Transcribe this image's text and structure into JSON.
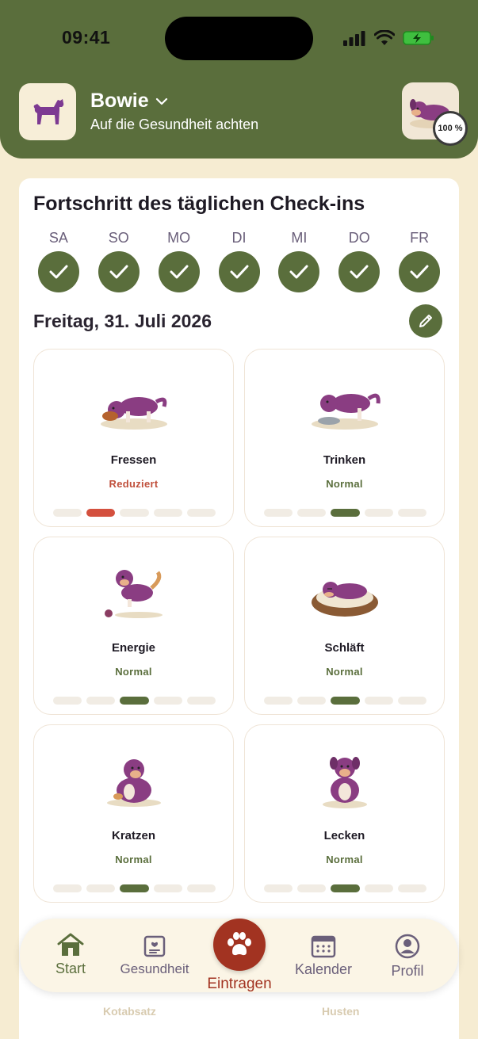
{
  "status_bar": {
    "time": "09:41"
  },
  "header": {
    "pet_name": "Bowie",
    "subtitle": "Auf die Gesundheit achten",
    "progress": "100 %",
    "progress_value": 100
  },
  "checkin": {
    "title": "Fortschritt des täglichen Check-ins",
    "days": [
      {
        "label": "SA",
        "done": true
      },
      {
        "label": "SO",
        "done": true
      },
      {
        "label": "MO",
        "done": true
      },
      {
        "label": "DI",
        "done": true
      },
      {
        "label": "MI",
        "done": true
      },
      {
        "label": "DO",
        "done": true
      },
      {
        "label": "FR",
        "done": true
      }
    ],
    "date": "Freitag, 31. Juli 2026"
  },
  "cards": [
    {
      "label": "Fressen",
      "status": "Reduziert",
      "level": 2,
      "tone": "bad"
    },
    {
      "label": "Trinken",
      "status": "Normal",
      "level": 3,
      "tone": "good"
    },
    {
      "label": "Energie",
      "status": "Normal",
      "level": 3,
      "tone": "good"
    },
    {
      "label": "Schläft",
      "status": "Normal",
      "level": 3,
      "tone": "good"
    },
    {
      "label": "Kratzen",
      "status": "Normal",
      "level": 3,
      "tone": "good"
    },
    {
      "label": "Lecken",
      "status": "Normal",
      "level": 3,
      "tone": "good"
    }
  ],
  "hidden_rows": {
    "left": "Kotabsatz",
    "right": "Husten"
  },
  "tabbar": {
    "home": "Start",
    "health": "Gesundheit",
    "add": "Eintragen",
    "calendar": "Kalender",
    "profile": "Profil"
  },
  "colors": {
    "primary_green": "#5a6e3c",
    "accent_red": "#a23321",
    "background": "#f6ecd2",
    "dog_purple": "#8a3d82"
  }
}
